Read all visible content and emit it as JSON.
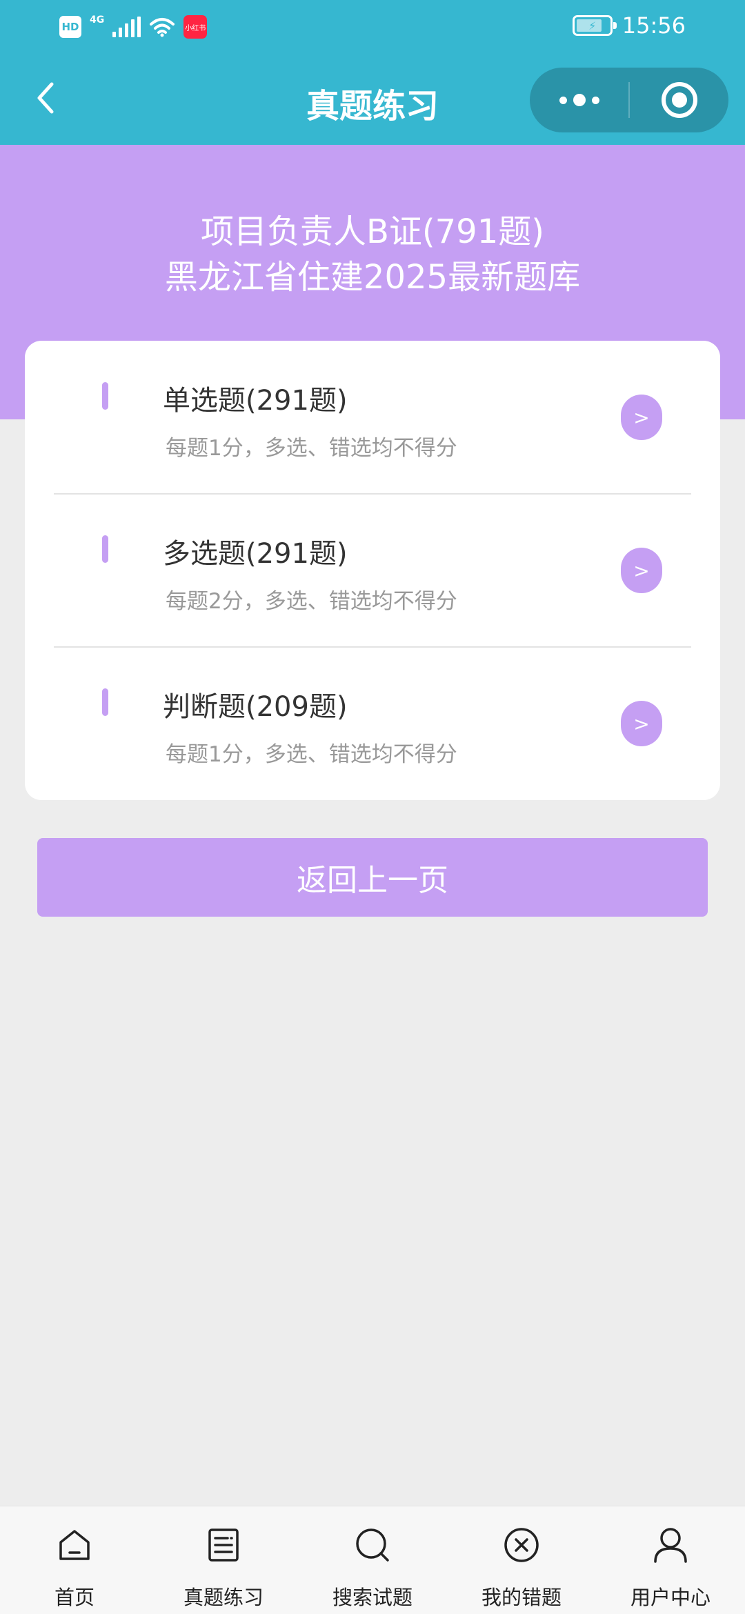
{
  "status_bar": {
    "hd_label": "HD",
    "network_label": "4G",
    "app_badge_label": "小红书",
    "time": "15:56"
  },
  "navbar": {
    "title": "真题练习",
    "back_icon": "chevron-left-icon",
    "more_icon": "more-dots-icon",
    "close_icon": "target-circle-icon"
  },
  "hero": {
    "line1": "项目负责人B证(791题)",
    "line2": "黑龙江省住建2025最新题库"
  },
  "categories": [
    {
      "title": "单选题(291题)",
      "desc": "每题1分，多选、错选均不得分",
      "arrow": ">"
    },
    {
      "title": "多选题(291题)",
      "desc": "每题2分，多选、错选均不得分",
      "arrow": ">"
    },
    {
      "title": "判断题(209题)",
      "desc": "每题1分，多选、错选均不得分",
      "arrow": ">"
    }
  ],
  "return_button": {
    "label": "返回上一页"
  },
  "tabbar": {
    "items": [
      {
        "label": "首页",
        "icon": "home-icon"
      },
      {
        "label": "真题练习",
        "icon": "document-list-icon"
      },
      {
        "label": "搜索试题",
        "icon": "search-icon"
      },
      {
        "label": "我的错题",
        "icon": "close-circle-icon"
      },
      {
        "label": "用户中心",
        "icon": "user-icon"
      }
    ]
  },
  "colors": {
    "topbar": "#36b7d0",
    "accent": "#c59ff3",
    "background": "#ededed"
  }
}
